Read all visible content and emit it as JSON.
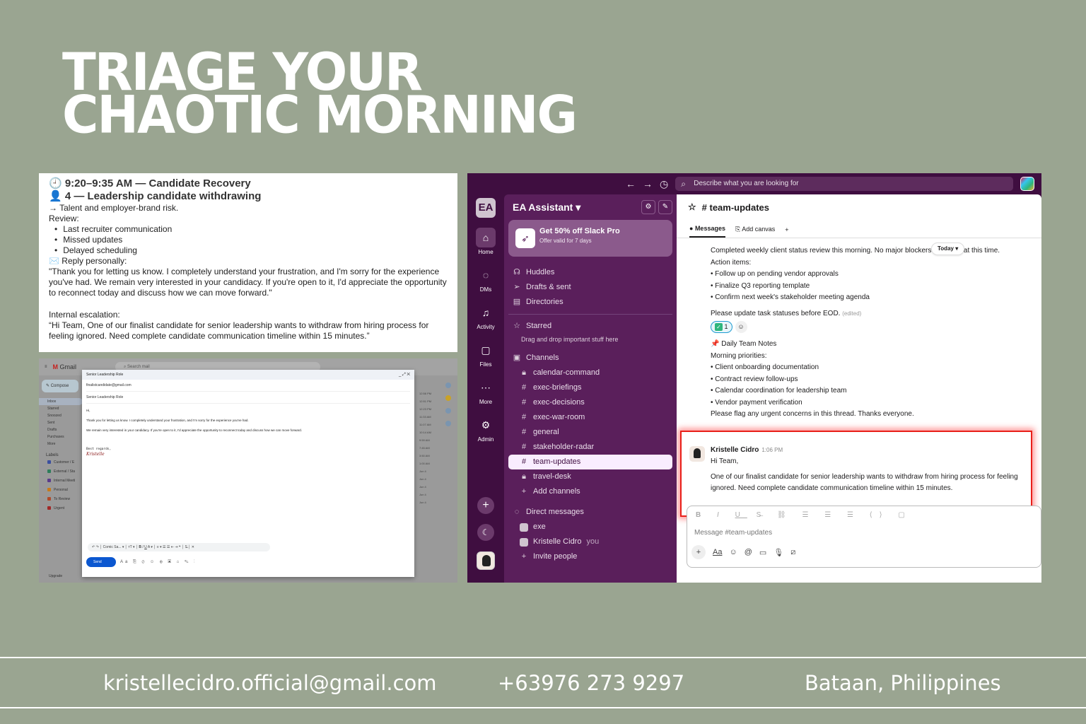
{
  "hero": {
    "line1": "TRIAGE YOUR",
    "line2": "CHAOTIC MORNING"
  },
  "doc": {
    "time_heading": "🕘 9:20–9:35 AM — Candidate Recovery",
    "case_heading": "👤 4 — Leadership candidate withdrawing",
    "risk": "→ Talent and employer-brand risk.",
    "review_label": "Review:",
    "review_items": [
      "Last recruiter communication",
      "Missed updates",
      "Delayed scheduling"
    ],
    "reply_label": "✉️  Reply personally:",
    "reply_text": "\"Thank you for letting us know. I completely understand your frustration, and I'm sorry for the experience you've had. We remain very interested in your candidacy. If you're open to it, I'd appreciate the opportunity to reconnect today and discuss how we can move forward.\"",
    "escalation_label": "Internal escalation:",
    "escalation_text": "“Hi Team, One of our finalist candidate for senior leadership wants to withdraw from hiring process for feeling ignored. Need complete candidate communication timeline within 15 minutes.”"
  },
  "gmail": {
    "app_name": "Gmail",
    "search_placeholder": "Search mail",
    "compose_label": "Compose",
    "folders": [
      "Inbox",
      "Starred",
      "Snoozed",
      "Sent",
      "Drafts",
      "Purchases",
      "More"
    ],
    "labels_heading": "Labels",
    "labels": [
      {
        "name": "Customer / E",
        "color": "#3b4fa0"
      },
      {
        "name": "External / Sta",
        "color": "#2e7d5b"
      },
      {
        "name": "Internal Meeti",
        "color": "#5a3b8a"
      },
      {
        "name": "Personal",
        "color": "#c77b1a"
      },
      {
        "name": "To Review",
        "color": "#b04a2a"
      },
      {
        "name": "Urgent",
        "color": "#a12828"
      }
    ],
    "times": [
      "12:56 PM",
      "12:51 PM",
      "12:23 PM",
      "11:33 AM",
      "11:07 AM",
      "10:14 AM",
      "9:59 AM",
      "7:45 AM",
      "3:50 AM",
      "1:00 AM",
      "Jun 4",
      "Jun 4",
      "Jun 4",
      "Jun 4",
      "Jun 4"
    ],
    "upgrade": "Upgrade",
    "compose": {
      "title": "Senior Leadership Role",
      "to": "finalistcandidate@gmail.com",
      "subject": "Senior Leadership Role",
      "greeting": "Hi,",
      "para1": "Thank you for letting us know. I completely understand your frustration, and I'm sorry for the experience you've had.",
      "para2": "We remain very interested in your candidacy. If you're open to it, I'd appreciate the opportunity to reconnect today and discuss how we can move forward.",
      "signoff": "Best regards,",
      "signature": "Kristelle",
      "font_label": "Comic Sa...",
      "send_label": "Send"
    }
  },
  "slack": {
    "search_placeholder": "Describe what you are looking for",
    "workspace_initials": "EA",
    "workspace_name": "EA Assistant",
    "rail": [
      {
        "label": "Home",
        "icon": "home-icon",
        "glyph": "⌂"
      },
      {
        "label": "DMs",
        "icon": "dms-icon",
        "glyph": "◌"
      },
      {
        "label": "Activity",
        "icon": "bell-icon",
        "glyph": "♫"
      },
      {
        "label": "Files",
        "icon": "files-icon",
        "glyph": "▢"
      },
      {
        "label": "More",
        "icon": "more-icon",
        "glyph": "⋯"
      },
      {
        "label": "Admin",
        "icon": "gear-icon",
        "glyph": "⚙"
      }
    ],
    "promo_title": "Get 50% off Slack Pro",
    "promo_sub": "Offer valid for 7 days",
    "nav": [
      "Huddles",
      "Drafts & sent",
      "Directories"
    ],
    "starred_label": "Starred",
    "starred_hint": "Drag and drop important stuff here",
    "channels_label": "Channels",
    "channels": [
      {
        "name": "calendar-command",
        "locked": true
      },
      {
        "name": "exec-briefings",
        "locked": false
      },
      {
        "name": "exec-decisions",
        "locked": false
      },
      {
        "name": "exec-war-room",
        "locked": false
      },
      {
        "name": "general",
        "locked": false
      },
      {
        "name": "stakeholder-radar",
        "locked": false
      },
      {
        "name": "team-updates",
        "locked": false,
        "active": true
      },
      {
        "name": "travel-desk",
        "locked": true
      }
    ],
    "add_channels": "Add channels",
    "dm_label": "Direct messages",
    "dms": [
      {
        "name": "exe",
        "you": ""
      },
      {
        "name": "Kristelle Cidro",
        "you": "you"
      }
    ],
    "invite": "Invite people",
    "channel_title": "# team-updates",
    "tabs": {
      "messages": "Messages",
      "canvas": "Add canvas"
    },
    "today": "Today",
    "msg1": {
      "body": "Completed weekly client status review this morning. No major blockers identified at this time.",
      "action_label": "Action items:",
      "items": [
        "• Follow up on pending vendor approvals",
        "• Finalize Q3 reporting template",
        "• Confirm next week's stakeholder meeting agenda"
      ],
      "footer": "Please update task statuses before EOD.",
      "edited": "(edited)",
      "reaction_count": "1"
    },
    "msg2": {
      "title": "📌 Daily Team Notes",
      "label": "Morning priorities:",
      "items": [
        "• Client onboarding documentation",
        "• Contract review follow-ups",
        "• Calendar coordination for leadership team",
        "• Vendor payment verification"
      ],
      "footer": "Please flag any urgent concerns in this thread. Thanks everyone."
    },
    "msg3": {
      "author": "Kristelle Cidro",
      "time": "1:06 PM",
      "greeting": "Hi Team,",
      "body": "One of our finalist candidate for senior leadership wants to withdraw from hiring process for feeling ignored. Need complete candidate communication timeline within 15 minutes."
    },
    "composer_placeholder": "Message #team-updates",
    "accent": "#3f0e40",
    "highlight_color": "#e8201a"
  },
  "footer": {
    "email": "kristellecidro.official@gmail.com",
    "phone": "+63976 273 9297",
    "location": "Bataan, Philippines"
  }
}
